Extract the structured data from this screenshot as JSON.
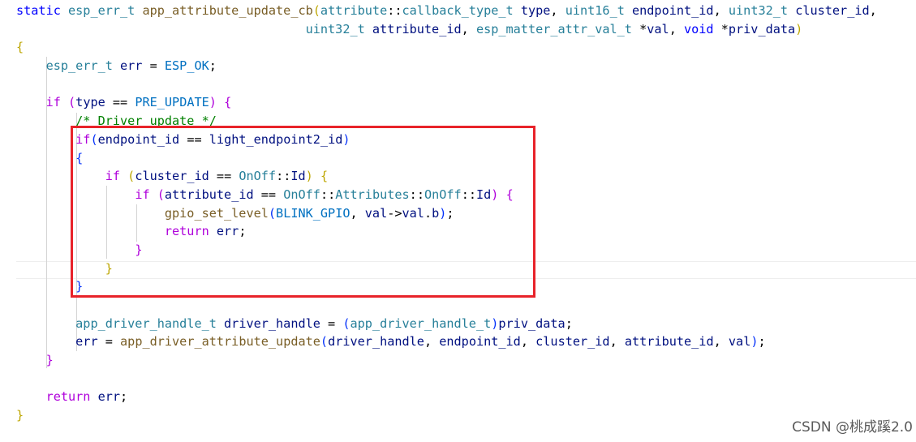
{
  "editor": {
    "lines": [
      [
        {
          "c": "kw",
          "t": "static "
        },
        {
          "c": "type",
          "t": "esp_err_t "
        },
        {
          "c": "fn",
          "t": "app_attribute_update_cb"
        },
        {
          "c": "br1",
          "t": "("
        },
        {
          "c": "type",
          "t": "attribute"
        },
        {
          "c": "pun",
          "t": "::"
        },
        {
          "c": "type",
          "t": "callback_type_t "
        },
        {
          "c": "var",
          "t": "type"
        },
        {
          "c": "pun",
          "t": ", "
        },
        {
          "c": "type",
          "t": "uint16_t "
        },
        {
          "c": "var",
          "t": "endpoint_id"
        },
        {
          "c": "pun",
          "t": ", "
        },
        {
          "c": "type",
          "t": "uint32_t "
        },
        {
          "c": "var",
          "t": "cluster_id"
        },
        {
          "c": "pun",
          "t": ","
        }
      ],
      [
        {
          "c": "pun",
          "t": "                                       "
        },
        {
          "c": "type",
          "t": "uint32_t "
        },
        {
          "c": "var",
          "t": "attribute_id"
        },
        {
          "c": "pun",
          "t": ", "
        },
        {
          "c": "type",
          "t": "esp_matter_attr_val_t "
        },
        {
          "c": "pun",
          "t": "*"
        },
        {
          "c": "var",
          "t": "val"
        },
        {
          "c": "pun",
          "t": ", "
        },
        {
          "c": "kw",
          "t": "void "
        },
        {
          "c": "pun",
          "t": "*"
        },
        {
          "c": "var",
          "t": "priv_data"
        },
        {
          "c": "br1",
          "t": ")"
        }
      ],
      [
        {
          "c": "br1",
          "t": "{"
        }
      ],
      [
        {
          "c": "pun",
          "t": "    "
        },
        {
          "c": "type",
          "t": "esp_err_t "
        },
        {
          "c": "var",
          "t": "err "
        },
        {
          "c": "pun",
          "t": "= "
        },
        {
          "c": "const",
          "t": "ESP_OK"
        },
        {
          "c": "pun",
          "t": ";"
        }
      ],
      [],
      [
        {
          "c": "pun",
          "t": "    "
        },
        {
          "c": "ctl",
          "t": "if "
        },
        {
          "c": "br2",
          "t": "("
        },
        {
          "c": "var",
          "t": "type "
        },
        {
          "c": "pun",
          "t": "== "
        },
        {
          "c": "const",
          "t": "PRE_UPDATE"
        },
        {
          "c": "br2",
          "t": ")"
        },
        {
          "c": "pun",
          "t": " "
        },
        {
          "c": "br2",
          "t": "{"
        }
      ],
      [
        {
          "c": "pun",
          "t": "        "
        },
        {
          "c": "cm",
          "t": "/* Driver update */"
        }
      ],
      [
        {
          "c": "pun",
          "t": "        "
        },
        {
          "c": "ctl",
          "t": "if"
        },
        {
          "c": "br3",
          "t": "("
        },
        {
          "c": "var",
          "t": "endpoint_id "
        },
        {
          "c": "pun",
          "t": "== "
        },
        {
          "c": "var",
          "t": "light_endpoint2_id"
        },
        {
          "c": "br3",
          "t": ")"
        }
      ],
      [
        {
          "c": "pun",
          "t": "        "
        },
        {
          "c": "br3",
          "t": "{"
        }
      ],
      [
        {
          "c": "pun",
          "t": "            "
        },
        {
          "c": "ctl",
          "t": "if "
        },
        {
          "c": "br1",
          "t": "("
        },
        {
          "c": "var",
          "t": "cluster_id "
        },
        {
          "c": "pun",
          "t": "== "
        },
        {
          "c": "type",
          "t": "OnOff"
        },
        {
          "c": "pun",
          "t": "::"
        },
        {
          "c": "var",
          "t": "Id"
        },
        {
          "c": "br1",
          "t": ")"
        },
        {
          "c": "pun",
          "t": " "
        },
        {
          "c": "br1",
          "t": "{"
        }
      ],
      [
        {
          "c": "pun",
          "t": "                "
        },
        {
          "c": "ctl",
          "t": "if "
        },
        {
          "c": "br2",
          "t": "("
        },
        {
          "c": "var",
          "t": "attribute_id "
        },
        {
          "c": "pun",
          "t": "== "
        },
        {
          "c": "type",
          "t": "OnOff"
        },
        {
          "c": "pun",
          "t": "::"
        },
        {
          "c": "type",
          "t": "Attributes"
        },
        {
          "c": "pun",
          "t": "::"
        },
        {
          "c": "type",
          "t": "OnOff"
        },
        {
          "c": "pun",
          "t": "::"
        },
        {
          "c": "var",
          "t": "Id"
        },
        {
          "c": "br2",
          "t": ")"
        },
        {
          "c": "pun",
          "t": " "
        },
        {
          "c": "br2",
          "t": "{"
        }
      ],
      [
        {
          "c": "pun",
          "t": "                    "
        },
        {
          "c": "fn",
          "t": "gpio_set_level"
        },
        {
          "c": "br3",
          "t": "("
        },
        {
          "c": "const",
          "t": "BLINK_GPIO"
        },
        {
          "c": "pun",
          "t": ", "
        },
        {
          "c": "var",
          "t": "val"
        },
        {
          "c": "pun",
          "t": "->"
        },
        {
          "c": "var",
          "t": "val"
        },
        {
          "c": "pun",
          "t": "."
        },
        {
          "c": "var",
          "t": "b"
        },
        {
          "c": "br3",
          "t": ")"
        },
        {
          "c": "pun",
          "t": ";"
        }
      ],
      [
        {
          "c": "pun",
          "t": "                    "
        },
        {
          "c": "ctl",
          "t": "return "
        },
        {
          "c": "var",
          "t": "err"
        },
        {
          "c": "pun",
          "t": ";"
        }
      ],
      [
        {
          "c": "pun",
          "t": "                "
        },
        {
          "c": "br2",
          "t": "}"
        }
      ],
      [
        {
          "c": "pun",
          "t": "            "
        },
        {
          "c": "br1",
          "t": "}"
        }
      ],
      [
        {
          "c": "pun",
          "t": "        "
        },
        {
          "c": "br3",
          "t": "}"
        }
      ],
      [],
      [
        {
          "c": "pun",
          "t": "        "
        },
        {
          "c": "type",
          "t": "app_driver_handle_t "
        },
        {
          "c": "var",
          "t": "driver_handle "
        },
        {
          "c": "pun",
          "t": "= "
        },
        {
          "c": "br3",
          "t": "("
        },
        {
          "c": "type",
          "t": "app_driver_handle_t"
        },
        {
          "c": "br3",
          "t": ")"
        },
        {
          "c": "var",
          "t": "priv_data"
        },
        {
          "c": "pun",
          "t": ";"
        }
      ],
      [
        {
          "c": "pun",
          "t": "        "
        },
        {
          "c": "var",
          "t": "err "
        },
        {
          "c": "pun",
          "t": "= "
        },
        {
          "c": "fn",
          "t": "app_driver_attribute_update"
        },
        {
          "c": "br3",
          "t": "("
        },
        {
          "c": "var",
          "t": "driver_handle"
        },
        {
          "c": "pun",
          "t": ", "
        },
        {
          "c": "var",
          "t": "endpoint_id"
        },
        {
          "c": "pun",
          "t": ", "
        },
        {
          "c": "var",
          "t": "cluster_id"
        },
        {
          "c": "pun",
          "t": ", "
        },
        {
          "c": "var",
          "t": "attribute_id"
        },
        {
          "c": "pun",
          "t": ", "
        },
        {
          "c": "var",
          "t": "val"
        },
        {
          "c": "br3",
          "t": ")"
        },
        {
          "c": "pun",
          "t": ";"
        }
      ],
      [
        {
          "c": "pun",
          "t": "    "
        },
        {
          "c": "br2",
          "t": "}"
        }
      ],
      [],
      [
        {
          "c": "pun",
          "t": "    "
        },
        {
          "c": "ctl",
          "t": "return "
        },
        {
          "c": "var",
          "t": "err"
        },
        {
          "c": "pun",
          "t": ";"
        }
      ],
      [
        {
          "c": "br1",
          "t": "}"
        }
      ]
    ]
  },
  "watermark": "CSDN @桃成蹊2.0"
}
